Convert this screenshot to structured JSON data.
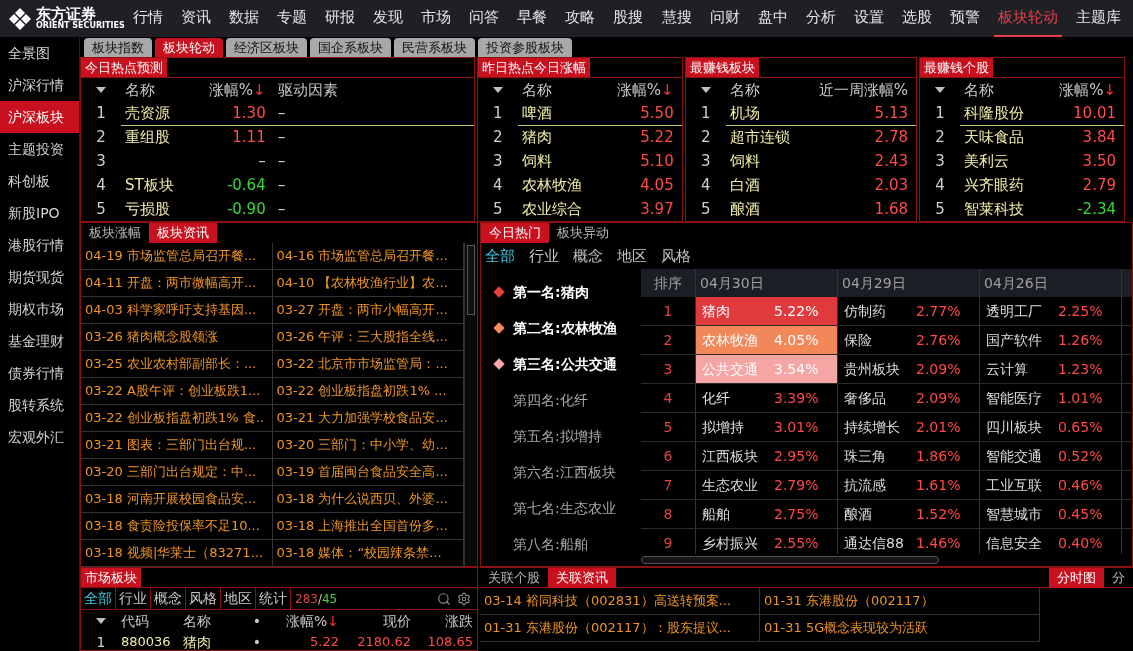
{
  "logo": {
    "name": "东方证券",
    "subtitle": "ORIENT SECURITIES"
  },
  "menu": [
    {
      "label": "行情",
      "selected": false
    },
    {
      "label": "资讯",
      "selected": false
    },
    {
      "label": "数据",
      "selected": false
    },
    {
      "label": "专题",
      "selected": false
    },
    {
      "label": "研报",
      "selected": false
    },
    {
      "label": "发现",
      "selected": false
    },
    {
      "label": "市场",
      "selected": false
    },
    {
      "label": "问答",
      "selected": false
    },
    {
      "label": "早餐",
      "selected": false
    },
    {
      "label": "攻略",
      "selected": false
    },
    {
      "label": "股搜",
      "selected": false
    },
    {
      "label": "慧搜",
      "selected": false
    },
    {
      "label": "问财",
      "selected": false
    },
    {
      "label": "盘中",
      "selected": false
    },
    {
      "label": "分析",
      "selected": false
    },
    {
      "label": "设置",
      "selected": false
    },
    {
      "label": "选股",
      "selected": false
    },
    {
      "label": "预警",
      "selected": false
    },
    {
      "label": "板块轮动",
      "selected": true
    },
    {
      "label": "主题库",
      "selected": false
    }
  ],
  "sidebar": [
    {
      "label": "全景图",
      "selected": false
    },
    {
      "label": "沪深行情",
      "selected": false
    },
    {
      "label": "沪深板块",
      "selected": true
    },
    {
      "label": "主题投资",
      "selected": false
    },
    {
      "label": "科创板",
      "selected": false
    },
    {
      "label": "新股IPO",
      "selected": false
    },
    {
      "label": "港股行情",
      "selected": false
    },
    {
      "label": "期货现货",
      "selected": false
    },
    {
      "label": "期权市场",
      "selected": false
    },
    {
      "label": "基金理财",
      "selected": false
    },
    {
      "label": "债券行情",
      "selected": false
    },
    {
      "label": "股转系统",
      "selected": false
    },
    {
      "label": "宏观外汇",
      "selected": false
    }
  ],
  "sheet_tabs": [
    {
      "label": "板块指数",
      "selected": false
    },
    {
      "label": "板块轮动",
      "selected": true
    },
    {
      "label": "经济区板块",
      "selected": false
    },
    {
      "label": "国企系板块",
      "selected": false
    },
    {
      "label": "民营系板块",
      "selected": false
    },
    {
      "label": "投资参股板块",
      "selected": false
    }
  ],
  "top_panels": [
    {
      "title": "今日热点预测",
      "columns": [
        {
          "label": "名称"
        },
        {
          "label": "涨幅%",
          "sort_mark": "↓"
        },
        {
          "label": "驱动因素"
        }
      ],
      "rows": [
        {
          "rank": "1",
          "name": "壳资源",
          "value": "1.30",
          "driver": "–",
          "color": "#ff4a4a",
          "selected": true
        },
        {
          "rank": "2",
          "name": "重组股",
          "value": "1.11",
          "driver": "–",
          "color": "#ff4a4a",
          "selected": false
        },
        {
          "rank": "3",
          "value": "–",
          "driver": "–",
          "color": "#d0d0d0",
          "selected": false
        },
        {
          "rank": "4",
          "name": "ST板块",
          "value": "-0.64",
          "driver": "–",
          "color": "#38d838",
          "selected": false
        },
        {
          "rank": "5",
          "name": "亏损股",
          "value": "-0.90",
          "driver": "–",
          "color": "#38d838",
          "selected": false
        }
      ]
    },
    {
      "title": "昨日热点今日涨幅",
      "columns": [
        {
          "label": "名称"
        },
        {
          "label": "涨幅%",
          "sort_mark": "↓"
        }
      ],
      "rows": [
        {
          "rank": "1",
          "name": "啤酒",
          "value": "5.50",
          "color": "#ff4a4a",
          "selected": true
        },
        {
          "rank": "2",
          "name": "猪肉",
          "value": "5.22",
          "color": "#ff4a4a",
          "selected": false
        },
        {
          "rank": "3",
          "name": "饲料",
          "value": "5.10",
          "color": "#ff4a4a",
          "selected": false
        },
        {
          "rank": "4",
          "name": "农林牧渔",
          "value": "4.05",
          "color": "#ff4a4a",
          "selected": false
        },
        {
          "rank": "5",
          "name": "农业综合",
          "value": "3.97",
          "color": "#ff4a4a",
          "selected": false
        }
      ]
    },
    {
      "title": "最赚钱板块",
      "columns": [
        {
          "label": "名称"
        },
        {
          "label": "近一周涨幅%"
        }
      ],
      "rows": [
        {
          "rank": "1",
          "name": "机场",
          "value": "5.13",
          "color": "#ff4a4a",
          "selected": true
        },
        {
          "rank": "2",
          "name": "超市连锁",
          "value": "2.78",
          "color": "#ff4a4a",
          "selected": false
        },
        {
          "rank": "3",
          "name": "饲料",
          "value": "2.43",
          "color": "#ff4a4a",
          "selected": false
        },
        {
          "rank": "4",
          "name": "白酒",
          "value": "2.03",
          "color": "#ff4a4a",
          "selected": false
        },
        {
          "rank": "5",
          "name": "酿酒",
          "value": "1.68",
          "color": "#ff4a4a",
          "selected": false
        }
      ]
    },
    {
      "title": "最赚钱个股",
      "columns": [
        {
          "label": "名称"
        },
        {
          "label": "涨幅%",
          "sort_mark": "↓"
        }
      ],
      "rows": [
        {
          "rank": "1",
          "name": "科隆股份",
          "value": "10.01",
          "color": "#ff4a4a",
          "selected": true
        },
        {
          "rank": "2",
          "name": "天味食品",
          "value": "3.84",
          "color": "#ff4a4a",
          "selected": false
        },
        {
          "rank": "3",
          "name": "美利云",
          "value": "3.50",
          "color": "#ff4a4a",
          "selected": false
        },
        {
          "rank": "4",
          "name": "兴齐眼药",
          "value": "2.79",
          "color": "#ff4a4a",
          "selected": false
        },
        {
          "rank": "5",
          "name": "智莱科技",
          "value": "-2.34",
          "color": "#38d838",
          "selected": false
        }
      ]
    }
  ],
  "news_panel": {
    "tabs": [
      {
        "label": "板块涨幅",
        "selected": false
      },
      {
        "label": "板块资讯",
        "selected": true
      }
    ],
    "items": [
      "04-19 市场监管总局召开餐...",
      "04-16 市场监管总局召开餐...",
      "04-11 开盘：两市微幅高开...",
      "04-10 【农林牧渔行业】农...",
      "04-03 科学家呼吁支持基因...",
      "03-27 开盘：两市小幅高开...",
      "03-26 猪肉概念股领涨",
      "03-26 午评：三大股指全线...",
      "03-25 农业农村部副部长：...",
      "03-22 北京市市场监管局：...",
      "03-22 A股午评：创业板跌1...",
      "03-22 创业板指盘初跌1% ...",
      "03-22 创业板指盘初跌1% 食..",
      "03-21 大力加强学校食品安...",
      "03-21 图表：三部门出台规...",
      "03-20 三部门：中小学、幼...",
      "03-20 三部门出台规定：中...",
      "03-19 首届闽台食品安全高...",
      "03-18 河南开展校园食品安...",
      "03-18 为什么说西贝、外婆...",
      "03-18 食责险投保率不足10...",
      "03-18 上海推出全国首份多...",
      "03-18 视频|华莱士（83271...",
      "03-18 媒体：“校园辣条禁..."
    ]
  },
  "hot_panel": {
    "tabs": [
      {
        "label": "今日热门",
        "selected": true
      },
      {
        "label": "板块异动",
        "selected": false
      }
    ],
    "filters": [
      {
        "label": "全部",
        "selected": true
      },
      {
        "label": "行业",
        "selected": false
      },
      {
        "label": "概念",
        "selected": false
      },
      {
        "label": "地区",
        "selected": false
      },
      {
        "label": "风格",
        "selected": false
      }
    ],
    "ranking": [
      {
        "label": "第一名:猪肉",
        "kind": "top",
        "color": "#e8403c"
      },
      {
        "label": "第二名:农林牧渔",
        "kind": "top",
        "color": "#f58a5c"
      },
      {
        "label": "第三名:公共交通",
        "kind": "top",
        "color": "#f7a8a8"
      },
      {
        "label": "第四名:化纤",
        "kind": "other"
      },
      {
        "label": "第五名:拟增持",
        "kind": "other"
      },
      {
        "label": "第六名:江西板块",
        "kind": "other"
      },
      {
        "label": "第七名:生态农业",
        "kind": "other"
      },
      {
        "label": "第八名:船舶",
        "kind": "other"
      }
    ],
    "table": {
      "rank_header": "排序",
      "columns": [
        "04月30日",
        "04月29日",
        "04月26日"
      ],
      "rows": [
        {
          "rank": "1",
          "cells": [
            {
              "name": "猪肉",
              "value": "5.22%",
              "color": "#e03a3c"
            },
            {
              "name": "仿制药",
              "value": "2.77%"
            },
            {
              "name": "透明工厂",
              "value": "2.25%"
            }
          ]
        },
        {
          "rank": "2",
          "cells": [
            {
              "name": "农林牧渔",
              "value": "4.05%",
              "color": "#f2875a"
            },
            {
              "name": "保险",
              "value": "2.76%"
            },
            {
              "name": "国产软件",
              "value": "1.26%"
            }
          ]
        },
        {
          "rank": "3",
          "cells": [
            {
              "name": "公共交通",
              "value": "3.54%",
              "color": "#f6a5a5"
            },
            {
              "name": "贵州板块",
              "value": "2.09%"
            },
            {
              "name": "云计算",
              "value": "1.23%"
            }
          ]
        },
        {
          "rank": "4",
          "cells": [
            {
              "name": "化纤",
              "value": "3.39%"
            },
            {
              "name": "奢侈品",
              "value": "2.09%"
            },
            {
              "name": "智能医疗",
              "value": "1.01%"
            }
          ]
        },
        {
          "rank": "5",
          "cells": [
            {
              "name": "拟增持",
              "value": "3.01%"
            },
            {
              "name": "持续增长",
              "value": "2.01%"
            },
            {
              "name": "四川板块",
              "value": "0.65%"
            }
          ]
        },
        {
          "rank": "6",
          "cells": [
            {
              "name": "江西板块",
              "value": "2.95%"
            },
            {
              "name": "珠三角",
              "value": "1.86%"
            },
            {
              "name": "智能交通",
              "value": "0.52%"
            }
          ]
        },
        {
          "rank": "7",
          "cells": [
            {
              "name": "生态农业",
              "value": "2.79%"
            },
            {
              "name": "抗流感",
              "value": "1.61%"
            },
            {
              "name": "工业互联",
              "value": "0.46%"
            }
          ]
        },
        {
          "rank": "8",
          "cells": [
            {
              "name": "船舶",
              "value": "2.75%"
            },
            {
              "name": "酿酒",
              "value": "1.52%"
            },
            {
              "name": "智慧城市",
              "value": "0.45%"
            }
          ]
        },
        {
          "rank": "9",
          "cells": [
            {
              "name": "乡村振兴",
              "value": "2.55%"
            },
            {
              "name": "通达信88",
              "value": "1.46%"
            },
            {
              "name": "信息安全",
              "value": "0.40%"
            }
          ]
        }
      ]
    }
  },
  "market_panel": {
    "title": "市场板块",
    "filters": [
      {
        "label": "全部",
        "selected": true
      },
      {
        "label": "行业",
        "selected": false
      },
      {
        "label": "概念",
        "selected": false
      },
      {
        "label": "风格",
        "selected": false
      },
      {
        "label": "地区",
        "selected": false
      },
      {
        "label": "统计",
        "selected": false
      }
    ],
    "up_count": "283",
    "separator": "/",
    "down_count": "45",
    "columns": [
      {
        "label": "代码"
      },
      {
        "label": "名称"
      },
      {
        "label": "•"
      },
      {
        "label": "涨幅%",
        "sort_mark": "↓"
      },
      {
        "label": "现价"
      },
      {
        "label": "涨跌"
      }
    ],
    "rows": [
      {
        "rank": "1",
        "code": "880036",
        "name": "猪肉",
        "dot": "•",
        "change_pct": "5.22",
        "price": "2180.62",
        "change": "108.65"
      }
    ]
  },
  "related_panel": {
    "tabs": [
      {
        "label": "关联个股",
        "selected": false
      },
      {
        "label": "关联资讯",
        "selected": true
      }
    ],
    "items": [
      "03-14 裕同科技（002831）高送转预案...",
      "01-31 东港股份（002117）",
      "01-31 东港股份（002117）：股东提议...",
      "01-31 5G概念表现较为活跃"
    ]
  },
  "chart_tabs": [
    {
      "label": "分时图",
      "selected": true
    },
    {
      "label": "分",
      "selected": false
    }
  ]
}
